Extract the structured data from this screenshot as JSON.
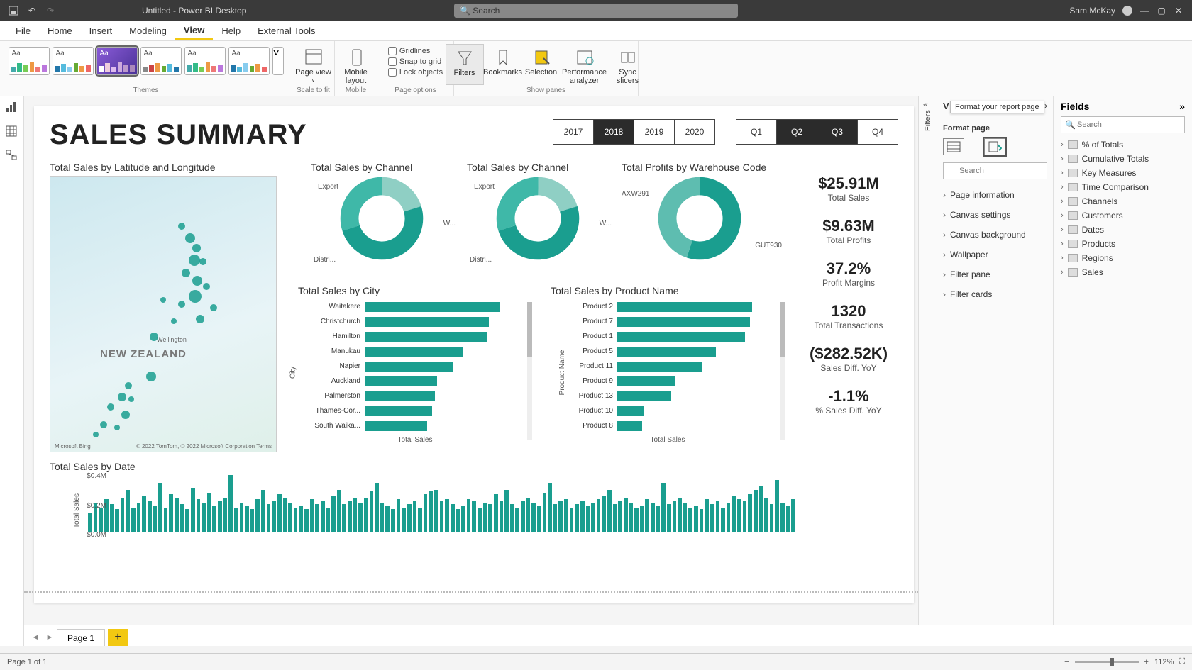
{
  "titlebar": {
    "title": "Untitled - Power BI Desktop",
    "search_placeholder": "Search",
    "user": "Sam McKay"
  },
  "menubar": {
    "items": [
      "File",
      "Home",
      "Insert",
      "Modeling",
      "View",
      "Help",
      "External Tools"
    ],
    "active_index": 4
  },
  "ribbon": {
    "themes_label": "Themes",
    "scale_label": "Scale to fit",
    "mobile_label": "Mobile",
    "page_options_label": "Page options",
    "show_panes_label": "Show panes",
    "page_view": "Page view",
    "mobile_layout": "Mobile layout",
    "gridlines": "Gridlines",
    "snap": "Snap to grid",
    "lock": "Lock objects",
    "filters": "Filters",
    "bookmarks": "Bookmarks",
    "selection": "Selection",
    "perf": "Performance analyzer",
    "sync": "Sync slicers"
  },
  "report": {
    "title": "SALES SUMMARY",
    "years": [
      "2017",
      "2018",
      "2019",
      "2020"
    ],
    "years_selected": [
      "2018"
    ],
    "quarters": [
      "Q1",
      "Q2",
      "Q3",
      "Q4"
    ],
    "quarters_selected": [
      "Q2",
      "Q3"
    ],
    "map_title": "Total Sales by Latitude and Longitude",
    "map_country": "NEW ZEALAND",
    "map_city": "Wellington",
    "map_attrib_left": "Microsoft Bing",
    "map_attrib_right": "© 2022 TomTom, © 2022 Microsoft Corporation   Terms",
    "donut1_title": "Total Sales by Channel",
    "donut2_title": "Total Sales by Channel",
    "donut3_title": "Total Profits by Warehouse Code",
    "donut_labels": {
      "export": "Export",
      "wholesale": "W...",
      "distri": "Distri..."
    },
    "donut3_labels": {
      "a": "AXW291",
      "b": "GUT930"
    },
    "cards": [
      {
        "val": "$25.91M",
        "lab": "Total Sales"
      },
      {
        "val": "$9.63M",
        "lab": "Total Profits"
      },
      {
        "val": "37.2%",
        "lab": "Profit Margins"
      },
      {
        "val": "1320",
        "lab": "Total Transactions"
      },
      {
        "val": "($282.52K)",
        "lab": "Sales Diff. YoY"
      },
      {
        "val": "-1.1%",
        "lab": "% Sales Diff. YoY"
      }
    ],
    "bar_city_title": "Total Sales by City",
    "bar_city_yaxis": "City",
    "bar_city_xaxis": "Total Sales",
    "bar_product_title": "Total Sales by Product Name",
    "bar_product_yaxis": "Product Name",
    "bar_product_xaxis": "Total Sales",
    "col_title": "Total Sales by Date",
    "col_yaxis": "Total Sales",
    "col_ticks": [
      "$0.4M",
      "$0.2M",
      "$0.0M"
    ]
  },
  "chart_data": [
    {
      "type": "bar",
      "title": "Total Sales by City",
      "ylabel": "City",
      "xlabel": "Total Sales",
      "categories": [
        "Waitakere",
        "Christchurch",
        "Hamilton",
        "Manukau",
        "Napier",
        "Auckland",
        "Palmerston",
        "Thames-Cor...",
        "South Waika..."
      ],
      "values": [
        130,
        120,
        118,
        95,
        85,
        70,
        68,
        65,
        60
      ]
    },
    {
      "type": "bar",
      "title": "Total Sales by Product Name",
      "ylabel": "Product Name",
      "xlabel": "Total Sales",
      "categories": [
        "Product 2",
        "Product 7",
        "Product 1",
        "Product 5",
        "Product 11",
        "Product 9",
        "Product 13",
        "Product 10",
        "Product 8"
      ],
      "values": [
        150,
        148,
        142,
        110,
        95,
        65,
        60,
        30,
        28
      ]
    },
    {
      "type": "pie",
      "title": "Total Sales by Channel",
      "categories": [
        "Export",
        "Wholesale",
        "Distributor"
      ],
      "values": [
        20,
        50,
        30
      ]
    },
    {
      "type": "pie",
      "title": "Total Profits by Warehouse Code",
      "categories": [
        "AXW291",
        "GUT930"
      ],
      "values": [
        55,
        45
      ]
    },
    {
      "type": "bar",
      "title": "Total Sales by Date",
      "ylabel": "Total Sales",
      "ylim": [
        0,
        400000
      ],
      "values": [
        120,
        180,
        150,
        200,
        170,
        140,
        210,
        260,
        150,
        180,
        220,
        190,
        160,
        300,
        150,
        230,
        210,
        170,
        140,
        270,
        200,
        180,
        240,
        160,
        190,
        210,
        350,
        150,
        180,
        160,
        140,
        200,
        260,
        170,
        190,
        230,
        210,
        180,
        150,
        160,
        140,
        200,
        170,
        190,
        150,
        220,
        260,
        170,
        190,
        210,
        180,
        210,
        250,
        300,
        180,
        160,
        140,
        200,
        150,
        170,
        190,
        150,
        230,
        250,
        260,
        190,
        200,
        170,
        140,
        160,
        200,
        190,
        150,
        180,
        170,
        230,
        190,
        260,
        170,
        150,
        190,
        210,
        180,
        160,
        240,
        300,
        170,
        190,
        200,
        150,
        170,
        190,
        160,
        180,
        200,
        220,
        260,
        170,
        190,
        210,
        180,
        150,
        160,
        200,
        180,
        160,
        300,
        170,
        190,
        210,
        180,
        150,
        160,
        140,
        200,
        170,
        190,
        150,
        180,
        220,
        200,
        190,
        230,
        260,
        280,
        210,
        170,
        320,
        180,
        160,
        200
      ]
    }
  ],
  "filters_label": "Filters",
  "viz_pane": {
    "title_letter": "V",
    "tooltip": "Format your report page",
    "subtitle": "Format page",
    "search_placeholder": "Search",
    "sections": [
      "Page information",
      "Canvas settings",
      "Canvas background",
      "Wallpaper",
      "Filter pane",
      "Filter cards"
    ]
  },
  "fields_pane": {
    "title": "Fields",
    "search_placeholder": "Search",
    "tables": [
      "% of Totals",
      "Cumulative Totals",
      "Key Measures",
      "Time Comparison",
      "Channels",
      "Customers",
      "Dates",
      "Products",
      "Regions",
      "Sales"
    ]
  },
  "pagetabs": {
    "page1": "Page 1"
  },
  "statusbar": {
    "left": "Page 1 of 1",
    "zoom": "112%"
  }
}
